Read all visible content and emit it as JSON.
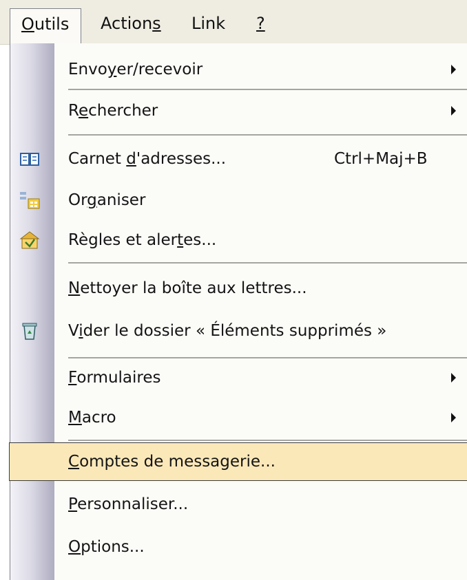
{
  "menubar": {
    "items": [
      {
        "pre": "",
        "key": "O",
        "post": "utils"
      },
      {
        "pre": "Action",
        "key": "s",
        "post": ""
      },
      {
        "pre": "Link",
        "key": "",
        "post": ""
      },
      {
        "pre": "",
        "key": "?",
        "post": ""
      }
    ]
  },
  "menu": {
    "items": [
      {
        "pre": "Envo",
        "key": "y",
        "post": "er/recevoir",
        "shortcut": "",
        "submenu": true,
        "icon": ""
      },
      {
        "pre": "R",
        "key": "e",
        "post": "chercher",
        "shortcut": "",
        "submenu": true,
        "icon": ""
      },
      {
        "pre": "Carnet ",
        "key": "d",
        "post": "'adresses...",
        "shortcut": "Ctrl+Maj+B",
        "submenu": false,
        "icon": "address-book-icon"
      },
      {
        "pre": "Or",
        "key": "g",
        "post": "aniser",
        "shortcut": "",
        "submenu": false,
        "icon": "organize-icon"
      },
      {
        "pre": "Règles et aler",
        "key": "t",
        "post": "es...",
        "shortcut": "",
        "submenu": false,
        "icon": "rules-icon"
      },
      {
        "pre": "",
        "key": "N",
        "post": "ettoyer la boîte aux lettres...",
        "shortcut": "",
        "submenu": false,
        "icon": ""
      },
      {
        "pre": "V",
        "key": "i",
        "post": "der le dossier « Éléments supprimés »",
        "shortcut": "",
        "submenu": false,
        "icon": "recycle-bin-icon"
      },
      {
        "pre": "",
        "key": "F",
        "post": "ormulaires",
        "shortcut": "",
        "submenu": true,
        "icon": ""
      },
      {
        "pre": "",
        "key": "M",
        "post": "acro",
        "shortcut": "",
        "submenu": true,
        "icon": ""
      },
      {
        "pre": "",
        "key": "C",
        "post": "omptes de messagerie...",
        "shortcut": "",
        "submenu": false,
        "icon": "",
        "highlighted": true
      },
      {
        "pre": "",
        "key": "P",
        "post": "ersonnaliser...",
        "shortcut": "",
        "submenu": false,
        "icon": ""
      },
      {
        "pre": "",
        "key": "O",
        "post": "ptions...",
        "shortcut": "",
        "submenu": false,
        "icon": ""
      }
    ]
  },
  "colors": {
    "menubar_bg": "#efede2",
    "highlight_bg": "#fbe8b9",
    "gutter_dark": "#aeacc0"
  }
}
